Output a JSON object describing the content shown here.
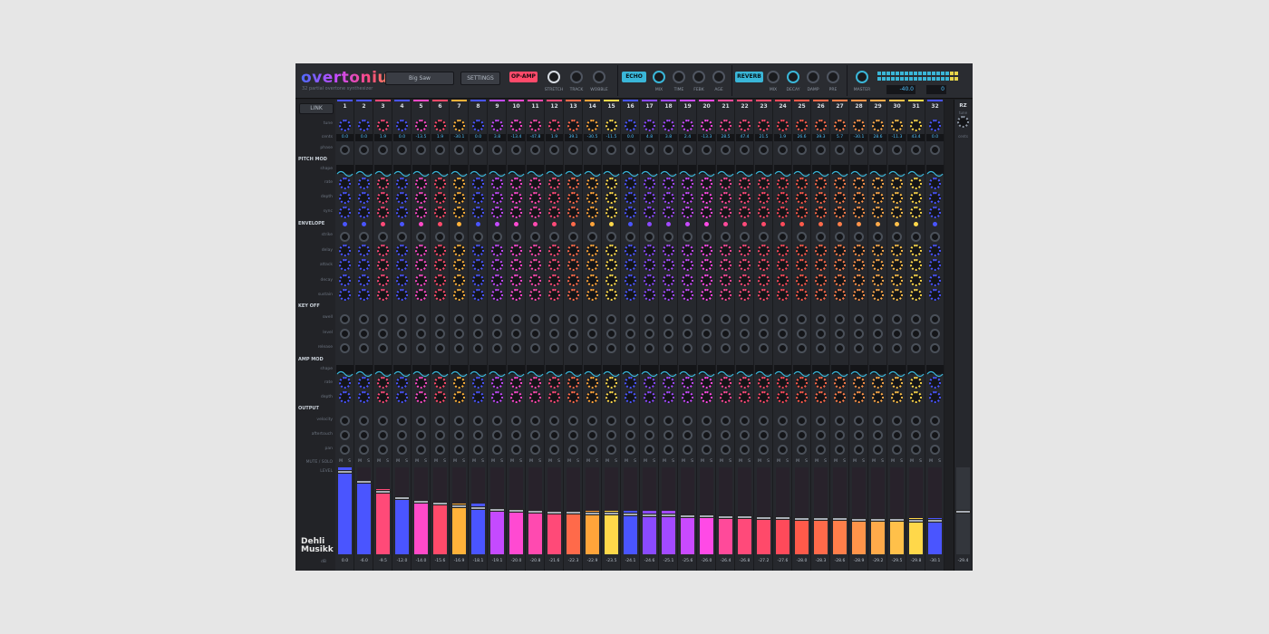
{
  "app": {
    "logo": "overtonium",
    "subtitle": "32 partial overtone synthesizer",
    "preset": "Big Saw",
    "settings": "SETTINGS",
    "opamp": {
      "tag": "OP-AMP",
      "knobs": [
        "STRETCH",
        "TRACK",
        "WOBBLE"
      ]
    },
    "echo": {
      "tag": "ECHO",
      "knobs": [
        "MIX",
        "TIME",
        "FEBK",
        "AGE"
      ]
    },
    "reverb": {
      "tag": "REVERB",
      "knobs": [
        "MIX",
        "DECAY",
        "DAMP",
        "PRE"
      ]
    },
    "master": {
      "label": "MASTER",
      "readout_left": "-40.0",
      "readout_right": "0"
    }
  },
  "labels": {
    "link": "LINK",
    "rows": {
      "tune": "tune",
      "cents": "cents",
      "phase": "phase",
      "shape": "shape",
      "rate": "rate",
      "depth": "depth",
      "sync": "sync",
      "strike": "strike",
      "delay": "delay",
      "attack": "attack",
      "decay": "decay",
      "sustain": "sustain",
      "swell": "swell",
      "level": "level",
      "release": "release",
      "velocity": "velocity",
      "aftertouch": "aftertouch",
      "pan": "pan",
      "mute_solo": "MUTE / SOLO",
      "level_out": "LEVEL",
      "db": "dB"
    },
    "sections": {
      "pitch_mod": "PITCH MOD",
      "envelope": "ENVELOPE",
      "key_off": "KEY OFF",
      "amp_mod": "AMP MOD",
      "output": "OUTPUT"
    },
    "mute": "M",
    "solo": "S"
  },
  "brand": {
    "line1": "Dehli",
    "line2": "Musikk"
  },
  "master_strip": {
    "label": "RZ",
    "sub1": "tune",
    "sub2": "cents",
    "readout": "-29.4"
  },
  "partials": {
    "numbers": [
      "1",
      "2",
      "3",
      "4",
      "5",
      "6",
      "7",
      "8",
      "9",
      "10",
      "11",
      "12",
      "13",
      "14",
      "15",
      "16",
      "17",
      "18",
      "19",
      "20",
      "21",
      "22",
      "23",
      "24",
      "25",
      "26",
      "27",
      "28",
      "29",
      "30",
      "31",
      "32"
    ],
    "cents": [
      "0.0",
      "0.0",
      "1.9",
      "0.0",
      "-13.5",
      "1.9",
      "-30.1",
      "0.0",
      "3.8",
      "-13.4",
      "-47.8",
      "1.9",
      "39.1",
      "-30.5",
      "-11.5",
      "0.0",
      "4.8",
      "3.8",
      "2.4",
      "-13.3",
      "28.5",
      "47.4",
      "21.5",
      "1.9",
      "26.6",
      "39.3",
      "5.7",
      "-30.1",
      "28.6",
      "-11.3",
      "43.4",
      "0.0"
    ],
    "levels_db": [
      "0.0",
      "-6.0",
      "-9.5",
      "-12.0",
      "-14.0",
      "-15.6",
      "-16.9",
      "-18.1",
      "-19.1",
      "-20.0",
      "-20.8",
      "-21.6",
      "-22.3",
      "-22.9",
      "-23.5",
      "-24.1",
      "-24.6",
      "-25.1",
      "-25.6",
      "-26.0",
      "-26.4",
      "-26.8",
      "-27.2",
      "-27.6",
      "-28.0",
      "-28.3",
      "-28.6",
      "-28.9",
      "-29.2",
      "-29.5",
      "-29.8",
      "-30.1"
    ],
    "level_fraction": [
      0.96,
      0.85,
      0.73,
      0.66,
      0.62,
      0.6,
      0.57,
      0.55,
      0.53,
      0.52,
      0.51,
      0.5,
      0.49,
      0.48,
      0.48,
      0.47,
      0.46,
      0.46,
      0.45,
      0.45,
      0.44,
      0.44,
      0.43,
      0.43,
      0.42,
      0.42,
      0.42,
      0.41,
      0.41,
      0.41,
      0.4,
      0.4
    ],
    "colors": [
      "#4a55ff",
      "#4a55ff",
      "#ff4a78",
      "#4a55ff",
      "#ff4ac8",
      "#ff4a6a",
      "#ffb23a",
      "#4a55ff",
      "#c44aff",
      "#ff4ad2",
      "#ff4ab0",
      "#ff4a78",
      "#ff6a4a",
      "#ffa43a",
      "#ffd84a",
      "#4a55ff",
      "#8a4aff",
      "#a24aff",
      "#c84aff",
      "#ff4ae6",
      "#ff4a9a",
      "#ff4a7a",
      "#ff4a6a",
      "#ff4a5a",
      "#ff5a4a",
      "#ff6a4a",
      "#ff7e4a",
      "#ff944a",
      "#ffaa4a",
      "#ffc04a",
      "#ffd84a",
      "#4a55ff"
    ]
  }
}
